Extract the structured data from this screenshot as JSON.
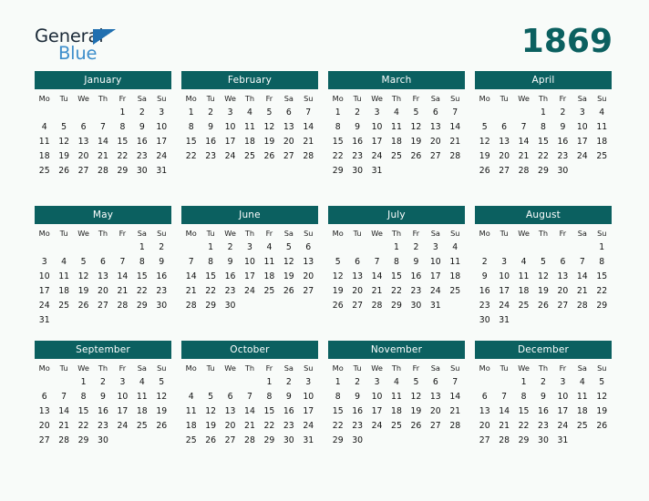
{
  "logo": {
    "line1": "General",
    "line2": "Blue",
    "wedge_icon": "triangle-wedge-icon",
    "color_general": "#1b2a38",
    "color_blue": "#3d8ecb",
    "color_wedge": "#1f6fb0"
  },
  "year": "1869",
  "accent_color": "#0b6060",
  "background_color": "#f8fbf9",
  "weekday_headers": [
    "Mo",
    "Tu",
    "We",
    "Th",
    "Fr",
    "Sa",
    "Su"
  ],
  "months": [
    {
      "name": "January",
      "start_weekday_index": 4,
      "days_in_month": 31,
      "weeks": [
        [
          "",
          "",
          "",
          "",
          "1",
          "2",
          "3"
        ],
        [
          "4",
          "5",
          "6",
          "7",
          "8",
          "9",
          "10"
        ],
        [
          "11",
          "12",
          "13",
          "14",
          "15",
          "16",
          "17"
        ],
        [
          "18",
          "19",
          "20",
          "21",
          "22",
          "23",
          "24"
        ],
        [
          "25",
          "26",
          "27",
          "28",
          "29",
          "30",
          "31"
        ]
      ]
    },
    {
      "name": "February",
      "start_weekday_index": 0,
      "days_in_month": 28,
      "weeks": [
        [
          "1",
          "2",
          "3",
          "4",
          "5",
          "6",
          "7"
        ],
        [
          "8",
          "9",
          "10",
          "11",
          "12",
          "13",
          "14"
        ],
        [
          "15",
          "16",
          "17",
          "18",
          "19",
          "20",
          "21"
        ],
        [
          "22",
          "23",
          "24",
          "25",
          "26",
          "27",
          "28"
        ]
      ]
    },
    {
      "name": "March",
      "start_weekday_index": 0,
      "days_in_month": 31,
      "weeks": [
        [
          "1",
          "2",
          "3",
          "4",
          "5",
          "6",
          "7"
        ],
        [
          "8",
          "9",
          "10",
          "11",
          "12",
          "13",
          "14"
        ],
        [
          "15",
          "16",
          "17",
          "18",
          "19",
          "20",
          "21"
        ],
        [
          "22",
          "23",
          "24",
          "25",
          "26",
          "27",
          "28"
        ],
        [
          "29",
          "30",
          "31",
          "",
          "",
          "",
          ""
        ]
      ]
    },
    {
      "name": "April",
      "start_weekday_index": 3,
      "days_in_month": 30,
      "weeks": [
        [
          "",
          "",
          "",
          "1",
          "2",
          "3",
          "4"
        ],
        [
          "5",
          "6",
          "7",
          "8",
          "9",
          "10",
          "11"
        ],
        [
          "12",
          "13",
          "14",
          "15",
          "16",
          "17",
          "18"
        ],
        [
          "19",
          "20",
          "21",
          "22",
          "23",
          "24",
          "25"
        ],
        [
          "26",
          "27",
          "28",
          "29",
          "30",
          "",
          ""
        ]
      ]
    },
    {
      "name": "May",
      "start_weekday_index": 5,
      "days_in_month": 31,
      "weeks": [
        [
          "",
          "",
          "",
          "",
          "",
          "1",
          "2"
        ],
        [
          "3",
          "4",
          "5",
          "6",
          "7",
          "8",
          "9"
        ],
        [
          "10",
          "11",
          "12",
          "13",
          "14",
          "15",
          "16"
        ],
        [
          "17",
          "18",
          "19",
          "20",
          "21",
          "22",
          "23"
        ],
        [
          "24",
          "25",
          "26",
          "27",
          "28",
          "29",
          "30"
        ],
        [
          "31",
          "",
          "",
          "",
          "",
          "",
          ""
        ]
      ]
    },
    {
      "name": "June",
      "start_weekday_index": 1,
      "days_in_month": 30,
      "weeks": [
        [
          "",
          "1",
          "2",
          "3",
          "4",
          "5",
          "6"
        ],
        [
          "7",
          "8",
          "9",
          "10",
          "11",
          "12",
          "13"
        ],
        [
          "14",
          "15",
          "16",
          "17",
          "18",
          "19",
          "20"
        ],
        [
          "21",
          "22",
          "23",
          "24",
          "25",
          "26",
          "27"
        ],
        [
          "28",
          "29",
          "30",
          "",
          "",
          "",
          ""
        ]
      ]
    },
    {
      "name": "July",
      "start_weekday_index": 3,
      "days_in_month": 31,
      "weeks": [
        [
          "",
          "",
          "",
          "1",
          "2",
          "3",
          "4"
        ],
        [
          "5",
          "6",
          "7",
          "8",
          "9",
          "10",
          "11"
        ],
        [
          "12",
          "13",
          "14",
          "15",
          "16",
          "17",
          "18"
        ],
        [
          "19",
          "20",
          "21",
          "22",
          "23",
          "24",
          "25"
        ],
        [
          "26",
          "27",
          "28",
          "29",
          "30",
          "31",
          ""
        ]
      ]
    },
    {
      "name": "August",
      "start_weekday_index": 6,
      "days_in_month": 31,
      "weeks": [
        [
          "",
          "",
          "",
          "",
          "",
          "",
          "1"
        ],
        [
          "2",
          "3",
          "4",
          "5",
          "6",
          "7",
          "8"
        ],
        [
          "9",
          "10",
          "11",
          "12",
          "13",
          "14",
          "15"
        ],
        [
          "16",
          "17",
          "18",
          "19",
          "20",
          "21",
          "22"
        ],
        [
          "23",
          "24",
          "25",
          "26",
          "27",
          "28",
          "29"
        ],
        [
          "30",
          "31",
          "",
          "",
          "",
          "",
          ""
        ]
      ]
    },
    {
      "name": "September",
      "start_weekday_index": 2,
      "days_in_month": 30,
      "weeks": [
        [
          "",
          "",
          "1",
          "2",
          "3",
          "4",
          "5"
        ],
        [
          "6",
          "7",
          "8",
          "9",
          "10",
          "11",
          "12"
        ],
        [
          "13",
          "14",
          "15",
          "16",
          "17",
          "18",
          "19"
        ],
        [
          "20",
          "21",
          "22",
          "23",
          "24",
          "25",
          "26"
        ],
        [
          "27",
          "28",
          "29",
          "30",
          "",
          "",
          ""
        ]
      ]
    },
    {
      "name": "October",
      "start_weekday_index": 4,
      "days_in_month": 31,
      "weeks": [
        [
          "",
          "",
          "",
          "",
          "1",
          "2",
          "3"
        ],
        [
          "4",
          "5",
          "6",
          "7",
          "8",
          "9",
          "10"
        ],
        [
          "11",
          "12",
          "13",
          "14",
          "15",
          "16",
          "17"
        ],
        [
          "18",
          "19",
          "20",
          "21",
          "22",
          "23",
          "24"
        ],
        [
          "25",
          "26",
          "27",
          "28",
          "29",
          "30",
          "31"
        ]
      ]
    },
    {
      "name": "November",
      "start_weekday_index": 0,
      "days_in_month": 30,
      "weeks": [
        [
          "1",
          "2",
          "3",
          "4",
          "5",
          "6",
          "7"
        ],
        [
          "8",
          "9",
          "10",
          "11",
          "12",
          "13",
          "14"
        ],
        [
          "15",
          "16",
          "17",
          "18",
          "19",
          "20",
          "21"
        ],
        [
          "22",
          "23",
          "24",
          "25",
          "26",
          "27",
          "28"
        ],
        [
          "29",
          "30",
          "",
          "",
          "",
          "",
          ""
        ]
      ]
    },
    {
      "name": "December",
      "start_weekday_index": 2,
      "days_in_month": 31,
      "weeks": [
        [
          "",
          "",
          "1",
          "2",
          "3",
          "4",
          "5"
        ],
        [
          "6",
          "7",
          "8",
          "9",
          "10",
          "11",
          "12"
        ],
        [
          "13",
          "14",
          "15",
          "16",
          "17",
          "18",
          "19"
        ],
        [
          "20",
          "21",
          "22",
          "23",
          "24",
          "25",
          "26"
        ],
        [
          "27",
          "28",
          "29",
          "30",
          "31",
          "",
          ""
        ]
      ]
    }
  ]
}
